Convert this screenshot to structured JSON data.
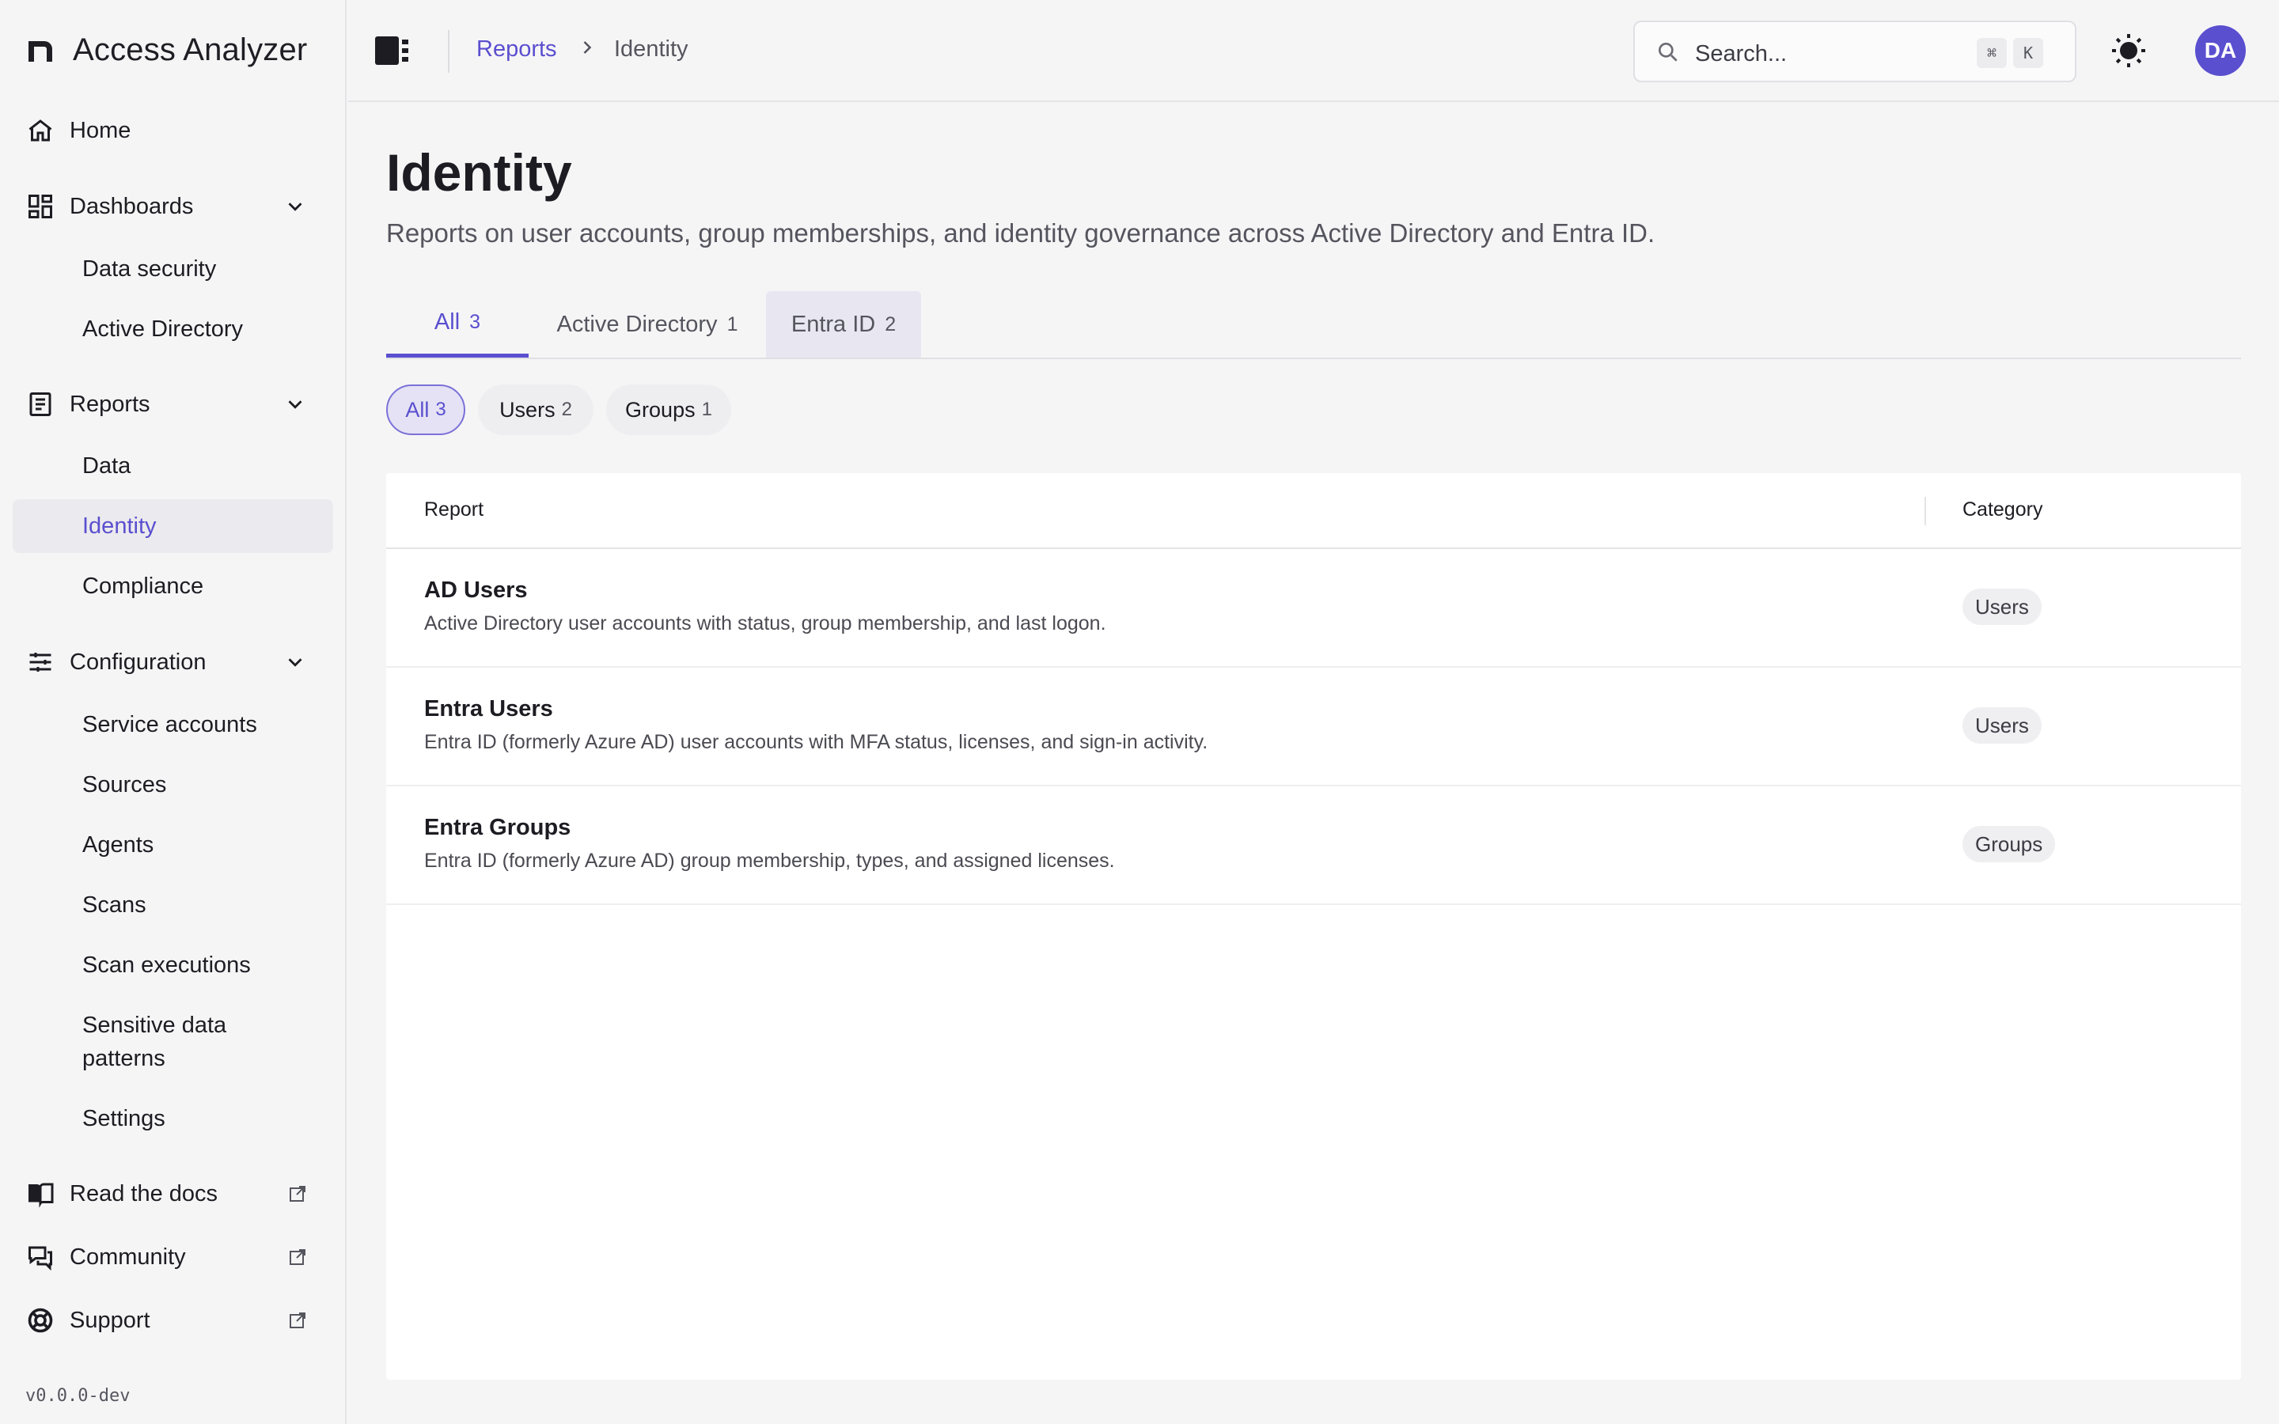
{
  "app": {
    "title": "Access Analyzer",
    "version": "v0.0.0-dev"
  },
  "sidebar": {
    "home": "Home",
    "dashboards": {
      "label": "Dashboards",
      "items": [
        "Data security",
        "Active Directory"
      ]
    },
    "reports": {
      "label": "Reports",
      "items": [
        "Data",
        "Identity",
        "Compliance"
      ]
    },
    "configuration": {
      "label": "Configuration",
      "items": [
        "Service accounts",
        "Sources",
        "Agents",
        "Scans",
        "Scan executions",
        "Sensitive data patterns",
        "Settings"
      ]
    },
    "links": [
      "Read the docs",
      "Community",
      "Support"
    ]
  },
  "topbar": {
    "breadcrumb": {
      "parent": "Reports",
      "current": "Identity"
    },
    "search": {
      "placeholder": "Search...",
      "key1": "⌘",
      "key2": "K"
    },
    "avatar": "DA"
  },
  "page": {
    "title": "Identity",
    "subtitle": "Reports on user accounts, group memberships, and identity governance across Active Directory and Entra ID."
  },
  "tabs": [
    {
      "label": "All",
      "count": "3"
    },
    {
      "label": "Active Directory",
      "count": "1"
    },
    {
      "label": "Entra ID",
      "count": "2"
    }
  ],
  "filters": [
    {
      "label": "All",
      "count": "3"
    },
    {
      "label": "Users",
      "count": "2"
    },
    {
      "label": "Groups",
      "count": "1"
    }
  ],
  "table": {
    "headers": {
      "report": "Report",
      "category": "Category"
    },
    "rows": [
      {
        "name": "AD Users",
        "description": "Active Directory user accounts with status, group membership, and last logon.",
        "category": "Users"
      },
      {
        "name": "Entra Users",
        "description": "Entra ID (formerly Azure AD) user accounts with MFA status, licenses, and sign-in activity.",
        "category": "Users"
      },
      {
        "name": "Entra Groups",
        "description": "Entra ID (formerly Azure AD) group membership, types, and assigned licenses.",
        "category": "Groups"
      }
    ]
  },
  "colors": {
    "accent": "#5a4fcf",
    "background": "#f6f5f6",
    "card": "#ffffff"
  }
}
